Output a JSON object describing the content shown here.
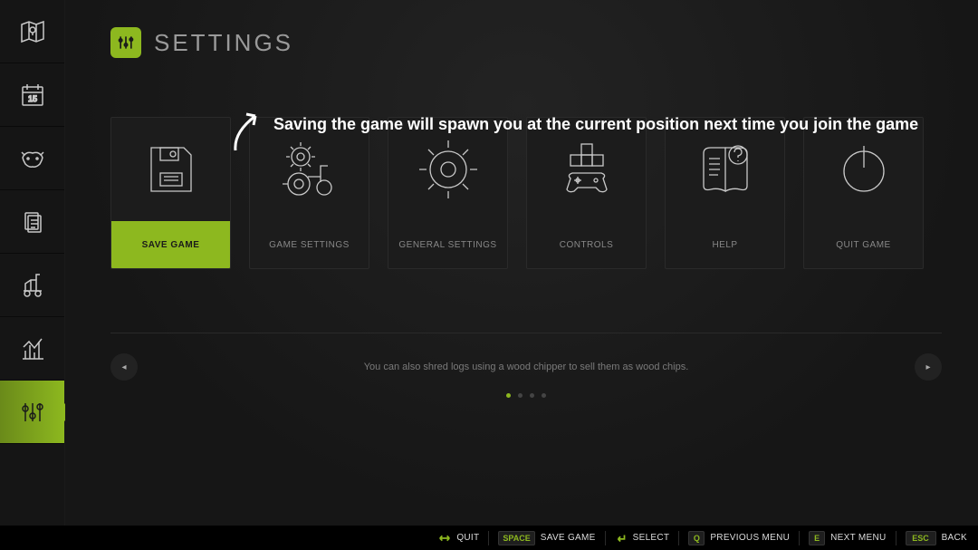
{
  "header": {
    "title": "SETTINGS"
  },
  "annotation": "Saving the game will spawn you at the current position next time you join the game",
  "tiles": {
    "save": "SAVE GAME",
    "game_settings": "GAME SETTINGS",
    "general_settings": "GENERAL SETTINGS",
    "controls": "CONTROLS",
    "help": "HELP",
    "quit": "QUIT GAME"
  },
  "hint": "You can also shred logs using a wood chipper to sell them as wood chips.",
  "footer": {
    "quit": {
      "label": "QUIT"
    },
    "save": {
      "key": "SPACE",
      "label": "SAVE GAME"
    },
    "select": {
      "label": "SELECT"
    },
    "prev": {
      "key": "Q",
      "label": "PREVIOUS MENU"
    },
    "next": {
      "key": "E",
      "label": "NEXT MENU"
    },
    "back": {
      "key": "ESC",
      "label": "BACK"
    }
  },
  "colors": {
    "accent": "#8db81f"
  }
}
